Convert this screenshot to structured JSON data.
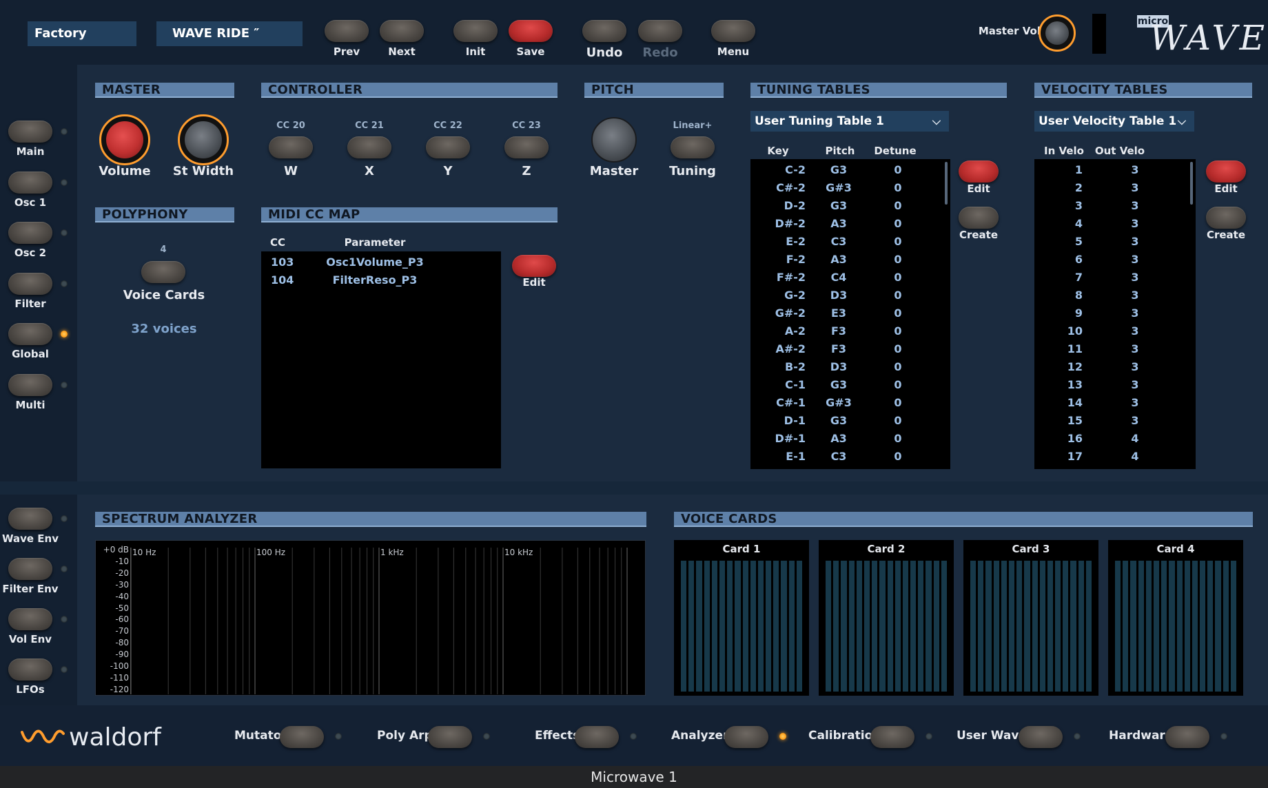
{
  "header": {
    "bank": "Factory",
    "preset": "WAVE RIDE  ″",
    "buttons": {
      "prev": "Prev",
      "next": "Next",
      "init": "Init",
      "save": "Save",
      "undo": "Undo",
      "redo": "Redo",
      "menu": "Menu"
    },
    "master_vol_label": "Master Vol",
    "logo_micro": "micro",
    "logo_wave": "WAVE"
  },
  "nav_left": [
    "Main",
    "Osc 1",
    "Osc 2",
    "Filter",
    "Global",
    "Multi"
  ],
  "nav_left_active": "Global",
  "nav_left2": [
    "Wave Env",
    "Filter Env",
    "Vol Env",
    "LFOs"
  ],
  "master": {
    "title": "MASTER",
    "volume": "Volume",
    "st_width": "St Width"
  },
  "controller": {
    "title": "CONTROLLER",
    "items": [
      {
        "cc": "CC 20",
        "label": "W"
      },
      {
        "cc": "CC 21",
        "label": "X"
      },
      {
        "cc": "CC 22",
        "label": "Y"
      },
      {
        "cc": "CC 23",
        "label": "Z"
      }
    ]
  },
  "pitch": {
    "title": "PITCH",
    "master": "Master",
    "tuning_mode": "Linear+",
    "tuning": "Tuning"
  },
  "polyphony": {
    "title": "POLYPHONY",
    "value": "4",
    "label": "Voice Cards",
    "voices": "32 voices"
  },
  "midi_cc_map": {
    "title": "MIDI CC MAP",
    "col_cc": "CC",
    "col_param": "Parameter",
    "rows": [
      {
        "cc": "103",
        "param": "Osc1Volume_P3"
      },
      {
        "cc": "104",
        "param": "FilterReso_P3"
      }
    ],
    "edit": "Edit"
  },
  "tuning_tables": {
    "title": "TUNING TABLES",
    "selected": "User Tuning Table 1",
    "col_key": "Key",
    "col_pitch": "Pitch",
    "col_detune": "Detune",
    "rows": [
      [
        "C-2",
        "G3",
        "0"
      ],
      [
        "C#-2",
        "G#3",
        "0"
      ],
      [
        "D-2",
        "G3",
        "0"
      ],
      [
        "D#-2",
        "A3",
        "0"
      ],
      [
        "E-2",
        "C3",
        "0"
      ],
      [
        "F-2",
        "A3",
        "0"
      ],
      [
        "F#-2",
        "C4",
        "0"
      ],
      [
        "G-2",
        "D3",
        "0"
      ],
      [
        "G#-2",
        "E3",
        "0"
      ],
      [
        "A-2",
        "F3",
        "0"
      ],
      [
        "A#-2",
        "F3",
        "0"
      ],
      [
        "B-2",
        "D3",
        "0"
      ],
      [
        "C-1",
        "G3",
        "0"
      ],
      [
        "C#-1",
        "G#3",
        "0"
      ],
      [
        "D-1",
        "G3",
        "0"
      ],
      [
        "D#-1",
        "A3",
        "0"
      ],
      [
        "E-1",
        "C3",
        "0"
      ]
    ],
    "edit": "Edit",
    "create": "Create"
  },
  "velocity_tables": {
    "title": "VELOCITY TABLES",
    "selected": "User Velocity Table 1",
    "col_in": "In Velo",
    "col_out": "Out Velo",
    "rows": [
      [
        "1",
        "3"
      ],
      [
        "2",
        "3"
      ],
      [
        "3",
        "3"
      ],
      [
        "4",
        "3"
      ],
      [
        "5",
        "3"
      ],
      [
        "6",
        "3"
      ],
      [
        "7",
        "3"
      ],
      [
        "8",
        "3"
      ],
      [
        "9",
        "3"
      ],
      [
        "10",
        "3"
      ],
      [
        "11",
        "3"
      ],
      [
        "12",
        "3"
      ],
      [
        "13",
        "3"
      ],
      [
        "14",
        "3"
      ],
      [
        "15",
        "3"
      ],
      [
        "16",
        "4"
      ],
      [
        "17",
        "4"
      ]
    ],
    "edit": "Edit",
    "create": "Create"
  },
  "spectrum": {
    "title": "SPECTRUM ANALYZER",
    "db_labels": [
      "+0 dB",
      "-10",
      "-20",
      "-30",
      "-40",
      "-50",
      "-60",
      "-70",
      "-80",
      "-90",
      "-100",
      "-110",
      "-120"
    ],
    "hz_labels": [
      "10 Hz",
      "100 Hz",
      "1 kHz",
      "10 kHz"
    ]
  },
  "voice_cards": {
    "title": "VOICE CARDS",
    "cards": [
      "Card 1",
      "Card 2",
      "Card 3",
      "Card 4"
    ]
  },
  "footer": {
    "brand": "waldorf",
    "items": [
      {
        "label": "Mutator",
        "active": false
      },
      {
        "label": "Poly Arp",
        "active": false
      },
      {
        "label": "Effects",
        "active": false
      },
      {
        "label": "Analyzer",
        "active": true
      },
      {
        "label": "Calibration",
        "active": false
      },
      {
        "label": "User Wave",
        "active": false
      },
      {
        "label": "Hardware",
        "active": false
      }
    ]
  },
  "window_title": "Microwave 1",
  "colors": {
    "accent_orange": "#ff9d2e",
    "button_red": "#c03030",
    "section_header": "#5e80a8",
    "table_text": "#9ec0e6"
  }
}
